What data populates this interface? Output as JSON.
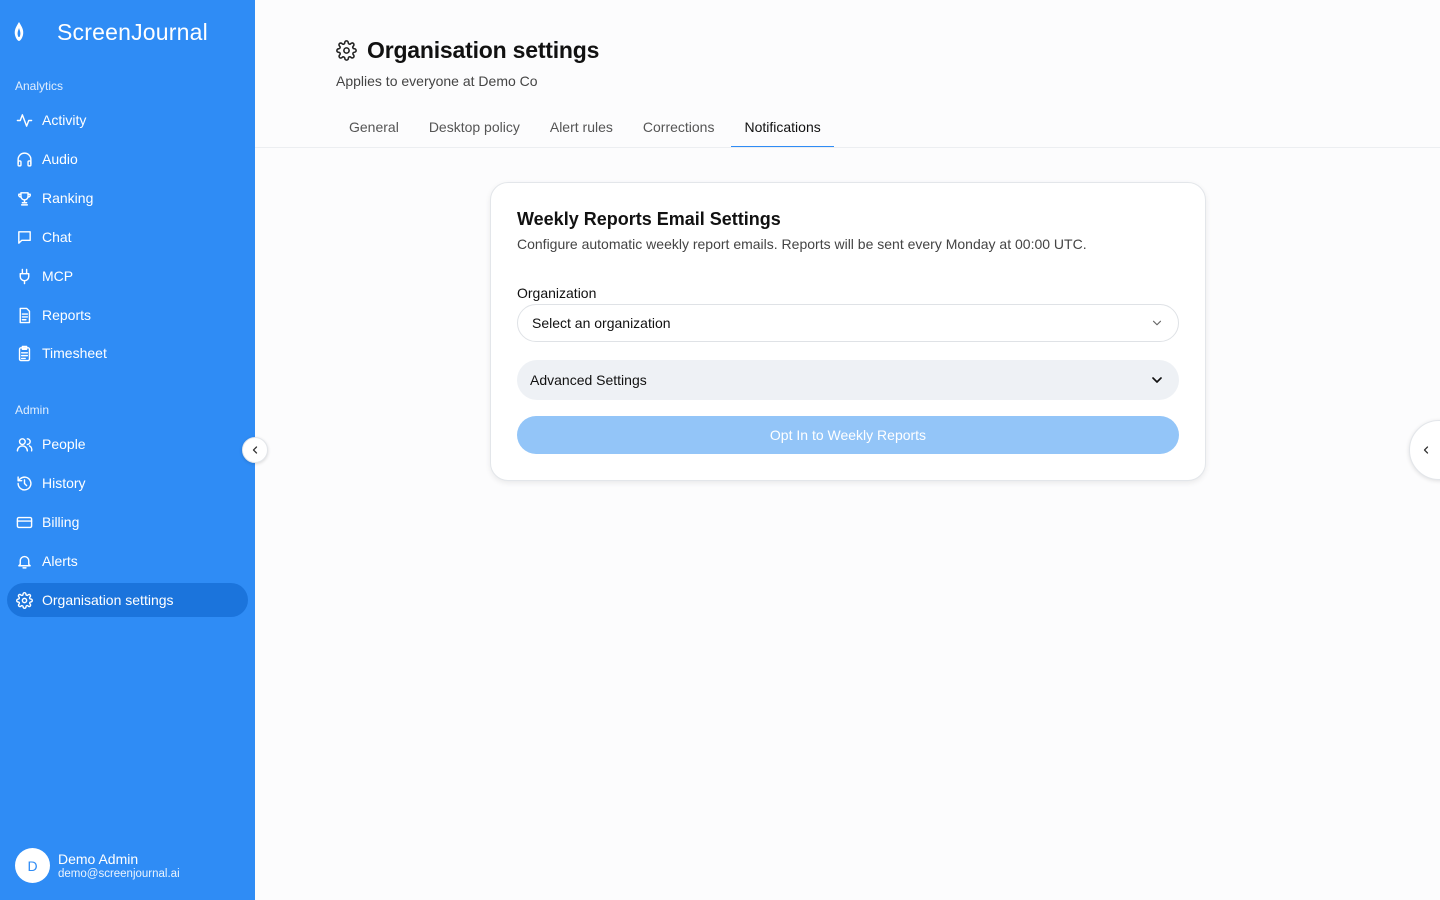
{
  "brand": {
    "name": "ScreenJournal",
    "logo_icon": "flame-icon"
  },
  "colors": {
    "sidebar": "#2f8cf5",
    "sidebar_active": "#1b74dc",
    "accent": "#2f8cf5",
    "button_disabled": "#93c5f8"
  },
  "sidebar": {
    "analytics_label": "Analytics",
    "analytics_items": [
      {
        "label": "Activity",
        "icon": "activity-icon"
      },
      {
        "label": "Audio",
        "icon": "headphones-icon"
      },
      {
        "label": "Ranking",
        "icon": "trophy-icon"
      },
      {
        "label": "Chat",
        "icon": "chat-icon"
      },
      {
        "label": "MCP",
        "icon": "plug-icon"
      },
      {
        "label": "Reports",
        "icon": "document-icon"
      },
      {
        "label": "Timesheet",
        "icon": "clipboard-icon"
      }
    ],
    "admin_label": "Admin",
    "admin_items": [
      {
        "label": "People",
        "icon": "users-icon"
      },
      {
        "label": "History",
        "icon": "history-icon"
      },
      {
        "label": "Billing",
        "icon": "credit-card-icon"
      },
      {
        "label": "Alerts",
        "icon": "bell-icon"
      },
      {
        "label": "Organisation settings",
        "icon": "gear-icon",
        "active": true
      }
    ],
    "user": {
      "initial": "D",
      "name": "Demo Admin",
      "email": "demo@screenjournal.ai"
    }
  },
  "page": {
    "title": "Organisation settings",
    "subtitle": "Applies to everyone at Demo Co",
    "tabs": [
      {
        "label": "General"
      },
      {
        "label": "Desktop policy"
      },
      {
        "label": "Alert rules"
      },
      {
        "label": "Corrections"
      },
      {
        "label": "Notifications",
        "active": true
      }
    ]
  },
  "card": {
    "title": "Weekly Reports Email Settings",
    "description": "Configure automatic weekly report emails. Reports will be sent every Monday at 00:00 UTC.",
    "organization_label": "Organization",
    "organization_placeholder": "Select an organization",
    "advanced_label": "Advanced Settings",
    "opt_in_label": "Opt In to Weekly Reports"
  }
}
